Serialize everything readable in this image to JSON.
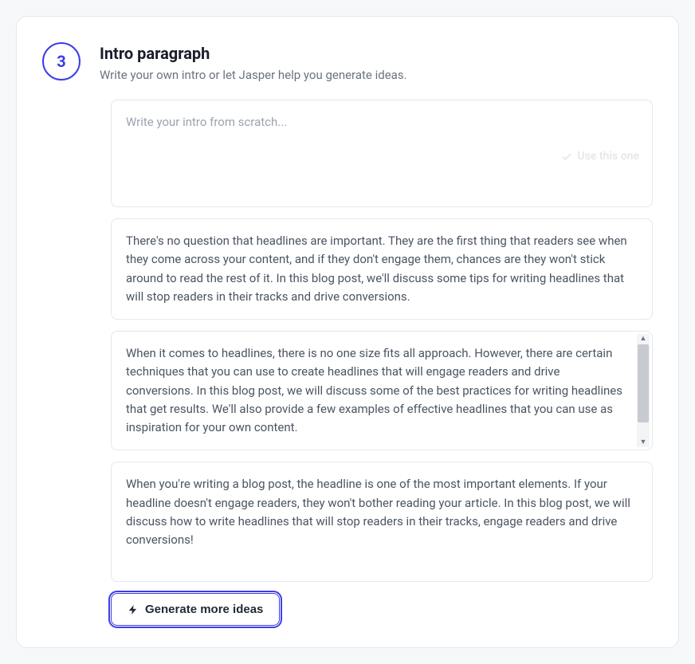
{
  "step": {
    "number": "3",
    "title": "Intro paragraph",
    "subtitle": "Write your own intro or let Jasper help you generate ideas."
  },
  "scratch": {
    "placeholder": "Write your intro from scratch...",
    "use_label": "Use this one"
  },
  "ideas": [
    {
      "text": "There's no question that headlines are important. They are the first thing that readers see when they come across your content, and if they don't engage them, chances are they won't stick around to read the rest of it. In this blog post, we'll discuss some tips for writing headlines that will stop readers in their tracks and drive conversions."
    },
    {
      "text": "When it comes to headlines, there is no one size fits all approach. However, there are certain techniques that you can use to create headlines that will engage readers and drive conversions. In this blog post, we will discuss some of the best practices for writing headlines that get results. We'll also provide a few examples of effective headlines that you can use as inspiration for your own content."
    },
    {
      "text": "When you're writing a blog post, the headline is one of the most important elements. If your headline doesn't engage readers, they won't bother reading your article. In this blog post, we will discuss how to write headlines that will stop readers in their tracks, engage readers and drive conversions!"
    }
  ],
  "actions": {
    "generate_more": "Generate more ideas"
  }
}
